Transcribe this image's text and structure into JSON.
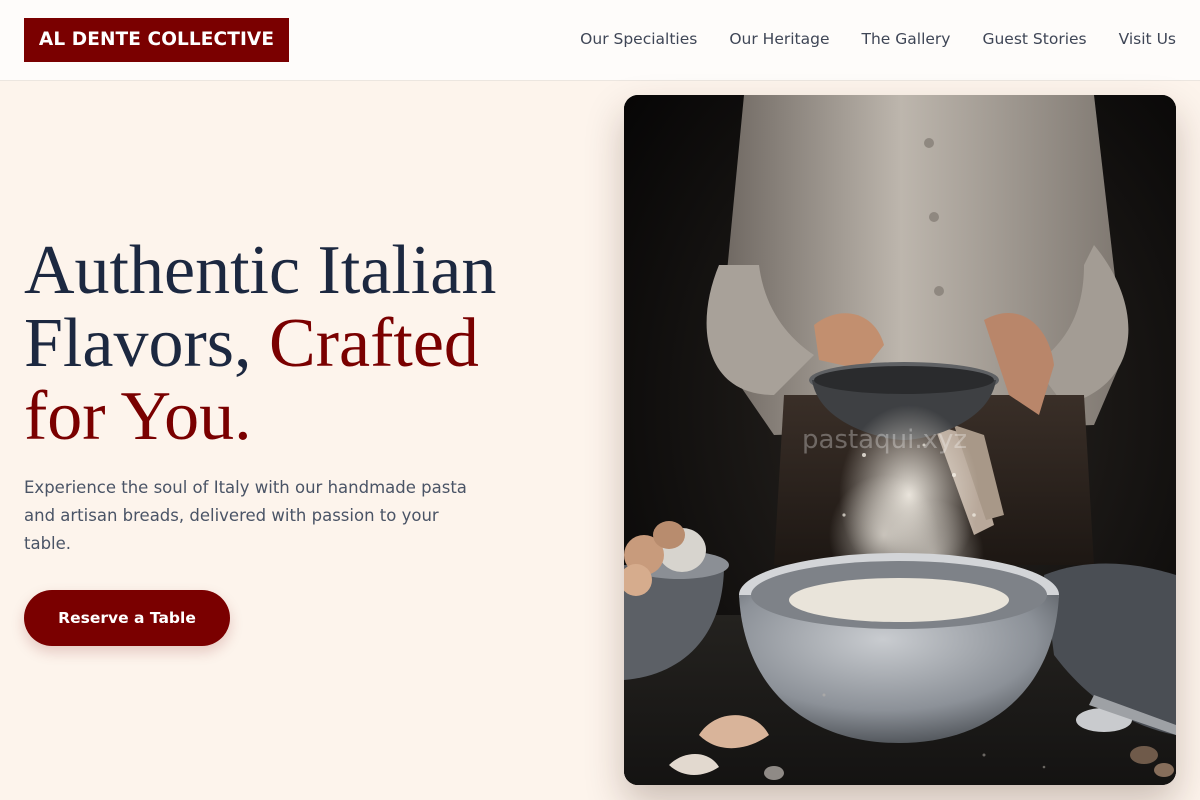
{
  "brand": {
    "name": "AL DENTE COLLECTIVE",
    "primary_color": "#7a0000",
    "heading_color": "#1c2840",
    "background_color": "#fdf4ec"
  },
  "nav": {
    "items": [
      {
        "label": "Our Specialties"
      },
      {
        "label": "Our Heritage"
      },
      {
        "label": "The Gallery"
      },
      {
        "label": "Guest Stories"
      },
      {
        "label": "Visit Us"
      }
    ]
  },
  "hero": {
    "title_line1": "Authentic Italian",
    "title_line2_plain": "Flavors, ",
    "title_line2_accent": "Crafted",
    "title_line3_accent": "for You.",
    "subtitle": "Experience the soul of Italy with our handmade pasta and artisan breads, delivered with passion to your table.",
    "cta_label": "Reserve a Table",
    "image": {
      "description_icon": "photo-flour-sifting",
      "watermark": "pastaqui.xyz"
    }
  }
}
